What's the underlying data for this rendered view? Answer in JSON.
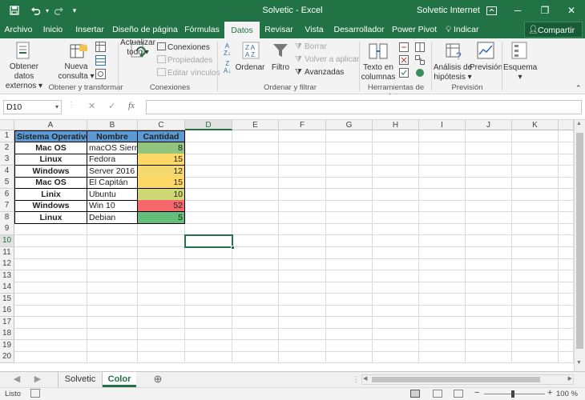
{
  "titlebar": {
    "title": "Solvetic  -  Excel",
    "user": "Solvetic Internet",
    "save_icon": "save-icon",
    "undo_icon": "undo-icon",
    "redo_icon": "redo-icon",
    "customize_icon": "chevron-down-icon",
    "ribbon_options_icon": "ribbon-display-icon",
    "minimize": "─",
    "restore": "❐",
    "close": "✕"
  },
  "tabs": [
    "Archivo",
    "Inicio",
    "Insertar",
    "Diseño de página",
    "Fórmulas",
    "Datos",
    "Revisar",
    "Vista",
    "Desarrollador",
    "Power Pivot"
  ],
  "active_tab": "Datos",
  "tell_me": "Indicar",
  "share": "Compartir",
  "ribbon": {
    "groups": {
      "get_transform": "Obtener y transformar",
      "connections": "Conexiones",
      "sort_filter": "Ordenar y filtrar",
      "data_tools": "Herramientas de datos",
      "forecast": "Previsión"
    },
    "get_external_1": "Obtener datos",
    "get_external_2": "externos",
    "new_query_1": "Nueva",
    "new_query_2": "consulta",
    "refresh_1": "Actualizar",
    "refresh_2": "todo",
    "connections": "Conexiones",
    "properties": "Propiedades",
    "edit_links": "Editar vínculos",
    "sort": "Ordenar",
    "filter": "Filtro",
    "clear": "Borrar",
    "reapply": "Volver a aplicar",
    "advanced": "Avanzadas",
    "text_columns_1": "Texto en",
    "text_columns_2": "columnas",
    "whatif_1": "Análisis de",
    "whatif_2": "hipótesis",
    "forecast_sheet": "Previsión",
    "outline": "Esquema"
  },
  "formula_bar": {
    "name_box": "D10",
    "cancel": "✕",
    "enter": "✓",
    "fx": "fx",
    "formula": ""
  },
  "grid": {
    "columns": [
      "A",
      "B",
      "C",
      "D",
      "E",
      "F",
      "G",
      "H",
      "I",
      "J",
      "K"
    ],
    "rows": [
      "1",
      "2",
      "3",
      "4",
      "5",
      "6",
      "7",
      "8",
      "9",
      "10",
      "11",
      "12",
      "13",
      "14",
      "15",
      "16",
      "17",
      "18",
      "19",
      "20"
    ],
    "selected_cell": "D10",
    "header_color": "#5b9bd5",
    "table_headers": [
      "Sistema Operativo",
      "Nombre",
      "Cantidad"
    ],
    "table_rows": [
      {
        "os": "Mac OS",
        "name": "macOS Sierra",
        "qty": "8",
        "color": "#92c47d"
      },
      {
        "os": "Linux",
        "name": "Fedora",
        "qty": "15",
        "color": "#ffd966"
      },
      {
        "os": "Windows",
        "name": "Server 2016",
        "qty": "12",
        "color": "#f6d96e"
      },
      {
        "os": "Mac OS",
        "name": "El Capitán",
        "qty": "15",
        "color": "#ffd966"
      },
      {
        "os": "Linix",
        "name": "Ubuntu",
        "qty": "10",
        "color": "#cfd874"
      },
      {
        "os": "Windows",
        "name": "Win 10",
        "qty": "52",
        "color": "#f4676b"
      },
      {
        "os": "Linux",
        "name": "Debian",
        "qty": "5",
        "color": "#63be7b"
      }
    ]
  },
  "sheets": [
    "Solvetic",
    "Color"
  ],
  "active_sheet": "Color",
  "status": {
    "ready": "Listo",
    "zoom": "100 %"
  }
}
